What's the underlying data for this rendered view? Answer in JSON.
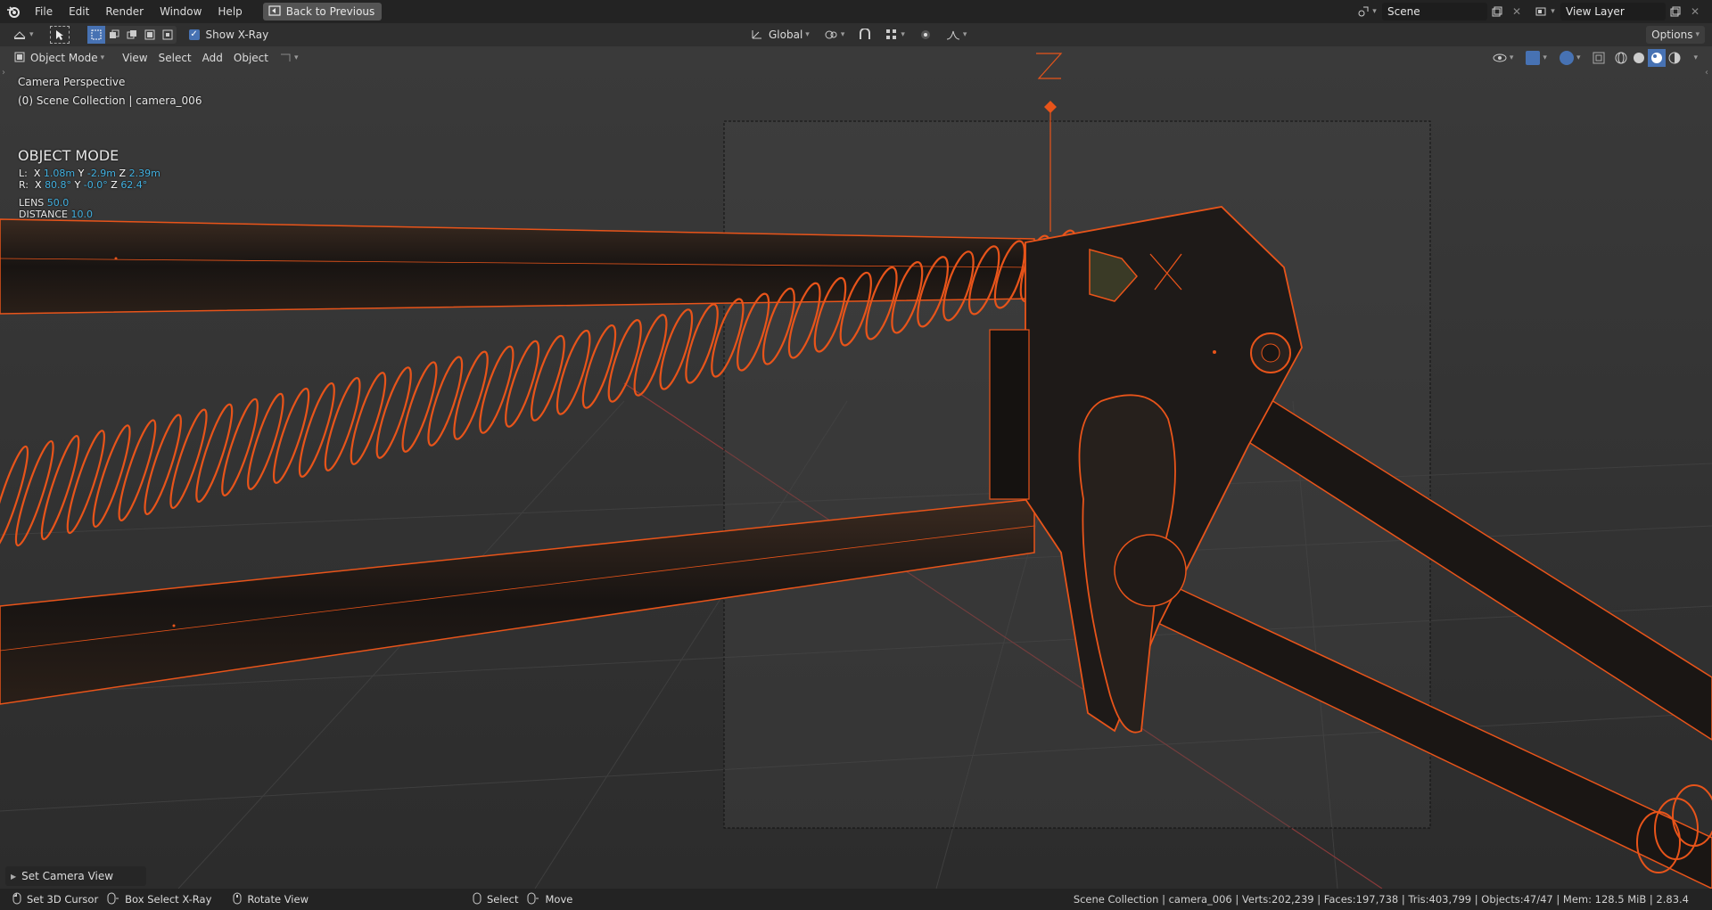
{
  "menus": [
    "File",
    "Edit",
    "Render",
    "Window",
    "Help"
  ],
  "back_button": "Back to Previous",
  "scene": {
    "value": "Scene"
  },
  "view_layer": {
    "value": "View Layer"
  },
  "tool_header": {
    "show_xray_label": "Show X-Ray",
    "orientation": "Global",
    "options_label": "Options"
  },
  "view_header": {
    "mode": "Object Mode",
    "menus": [
      "View",
      "Select",
      "Add",
      "Object"
    ]
  },
  "overlay": {
    "camera_title": "Camera Perspective",
    "collection": "(0) Scene Collection | camera_006",
    "mode_title": "OBJECT MODE",
    "location": {
      "prefix": "L:",
      "x": "1.08m",
      "y": "-2.9m",
      "z": "2.39m"
    },
    "rotation": {
      "prefix": "R:",
      "x": "80.8°",
      "y": "-0.0°",
      "z": "62.4°"
    },
    "lens": {
      "label": "LENS",
      "value": "50.0"
    },
    "distance": {
      "label": "DISTANCE",
      "value": "10.0"
    },
    "axis_labels": {
      "x": "X",
      "y": "Y",
      "z": "Z"
    }
  },
  "last_op_panel": "Set Camera View",
  "statusbar": {
    "items": [
      "Set 3D Cursor",
      "Box Select X-Ray",
      "Rotate View",
      "Select",
      "Move"
    ],
    "info": "Scene Collection | camera_006 | Verts:202,239 | Faces:197,738 | Tris:403,799 | Objects:47/47 | Mem: 128.5 MiB | 2.83.4"
  },
  "colors": {
    "accent": "#4772b3",
    "selection": "#e8541a",
    "value_blue": "#41b0e0"
  },
  "icons": [
    "blender-logo-icon",
    "camera-back-icon",
    "scene-icon",
    "view-layer-icon",
    "select-tool-icon",
    "xray-checkbox-icon",
    "pivot-icon",
    "snap-icon",
    "proportional-icon",
    "mouse-icon"
  ]
}
